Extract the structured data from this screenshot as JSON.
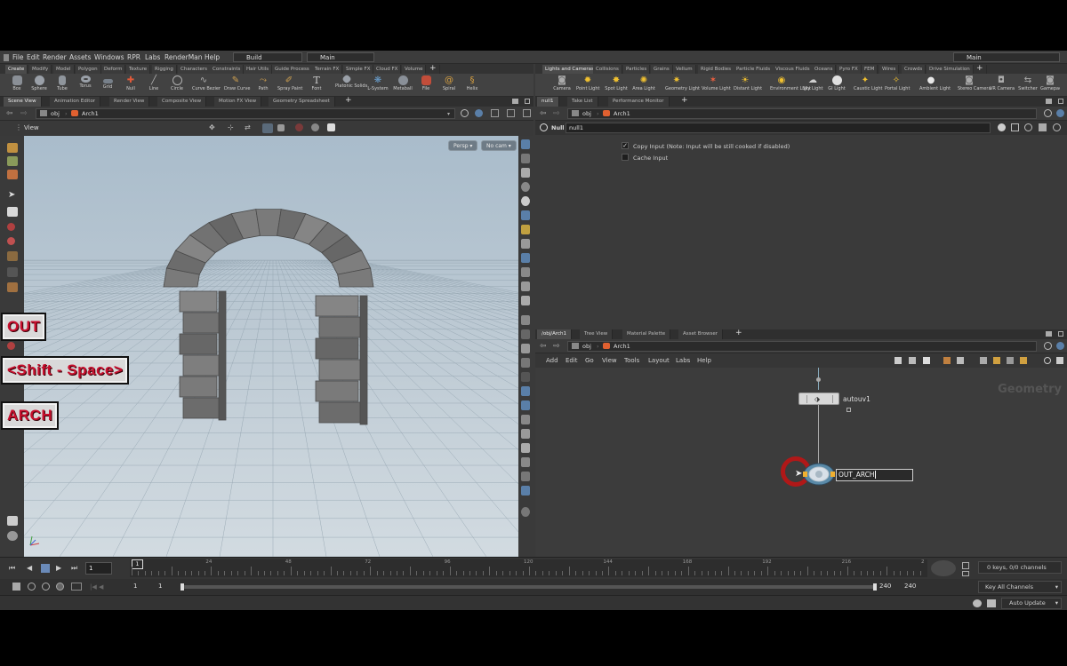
{
  "menubar": {
    "items": [
      "File",
      "Edit",
      "Render",
      "Assets",
      "Windows",
      "RPR",
      "Labs",
      "RenderMan",
      "Help"
    ],
    "desktop": "Build",
    "context": "Main",
    "right_context": "Main"
  },
  "shelf_left": {
    "tabs": [
      "Create",
      "Modify",
      "Model",
      "Polygon",
      "Deform",
      "Texture",
      "Rigging",
      "Characters",
      "Constraints",
      "Hair Utils",
      "Guide Process",
      "Terrain FX",
      "Simple FX",
      "Cloud FX",
      "Volume"
    ],
    "tools": [
      "Box",
      "Sphere",
      "Tube",
      "Torus",
      "Grid",
      "Null",
      "Line",
      "Circle",
      "Curve Bezier",
      "Draw Curve",
      "Path",
      "Spray Paint",
      "Font",
      "Platonic Solids",
      "L-System",
      "Metaball",
      "File",
      "Spiral",
      "Helix"
    ]
  },
  "shelf_right": {
    "tabs": [
      "Lights and Cameras",
      "Collisions",
      "Particles",
      "Grains",
      "Vellum",
      "Rigid Bodies",
      "Particle Fluids",
      "Viscous Fluids",
      "Oceans",
      "Pyro FX",
      "FEM",
      "Wires",
      "Crowds",
      "Drive Simulation"
    ],
    "tools": [
      "Camera",
      "Point Light",
      "Spot Light",
      "Area Light",
      "Geometry Light",
      "Volume Light",
      "Distant Light",
      "Environment Light",
      "Sky Light",
      "GI Light",
      "Caustic Light",
      "Portal Light",
      "Ambient Light",
      "Stereo Camera",
      "VR Camera",
      "Switcher",
      "Gamepad Ca"
    ]
  },
  "left_pane": {
    "tabs": [
      "Scene View",
      "Animation Editor",
      "Render View",
      "Composite View",
      "Motion FX View",
      "Geometry Spreadsheet"
    ],
    "path": [
      "obj",
      "Arch1"
    ],
    "view_label": "View",
    "persp": "Persp",
    "cam": "No cam"
  },
  "overlays": [
    "OUT",
    "<Shift - Space>",
    "ARCH"
  ],
  "param_pane": {
    "tabs": [
      "null1",
      "Take List",
      "Performance Monitor"
    ],
    "path": [
      "obj",
      "Arch1"
    ],
    "node_type": "Null",
    "node_name": "null1",
    "params": [
      {
        "label": "Copy Input (Note: Input will be still cooked if disabled)",
        "checked": true
      },
      {
        "label": "Cache Input",
        "checked": false
      }
    ]
  },
  "network_pane": {
    "tabs": [
      "/obj/Arch1",
      "Tree View",
      "Material Palette",
      "Asset Browser"
    ],
    "path": [
      "obj",
      "Arch1"
    ],
    "menu": [
      "Add",
      "Edit",
      "Go",
      "View",
      "Tools",
      "Layout",
      "Labs",
      "Help"
    ],
    "watermark": "Geometry",
    "node1": "autouv1",
    "node2_name_edit": "OUT_ARCH"
  },
  "timeline": {
    "current_frame": "1",
    "ticks": [
      "1",
      "24",
      "48",
      "72",
      "96",
      "120",
      "144",
      "168",
      "192",
      "216",
      "2"
    ],
    "range_start": "1",
    "range_start2": "1",
    "range_end": "240",
    "range_end2": "240",
    "keys": "0 keys, 0/0 channels",
    "key_all": "Key All Channels",
    "auto_update": "Auto Update"
  },
  "colors": {
    "accent": "#c8102e",
    "viewport_top": "#a9bccb",
    "viewport_bottom": "#d2dbe1"
  }
}
